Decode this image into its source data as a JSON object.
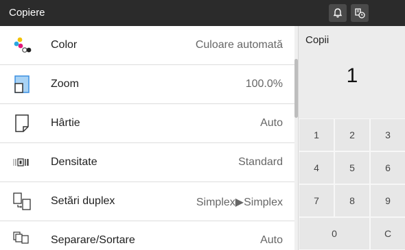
{
  "header": {
    "title": "Copiere"
  },
  "settings": [
    {
      "label": "Color",
      "value": "Culoare automată",
      "icon": "color-dots-icon"
    },
    {
      "label": "Zoom",
      "value": "100.0%",
      "icon": "zoom-icon"
    },
    {
      "label": "Hârtie",
      "value": "Auto",
      "icon": "paper-icon"
    },
    {
      "label": "Densitate",
      "value": "Standard",
      "icon": "density-icon"
    },
    {
      "label": "Setări duplex",
      "value": "Simplex▶Simplex",
      "icon": "duplex-icon"
    },
    {
      "label": "Separare/Sortare",
      "value": "Auto",
      "icon": "sort-icon"
    }
  ],
  "copies": {
    "label": "Copii",
    "value": "1"
  },
  "keypad": [
    "1",
    "2",
    "3",
    "4",
    "5",
    "6",
    "7",
    "8",
    "9",
    "0",
    "C"
  ],
  "colors": {
    "topbar": "#2b2b2b",
    "accent_blue": "#3a8ee0",
    "panel": "#ececec"
  }
}
